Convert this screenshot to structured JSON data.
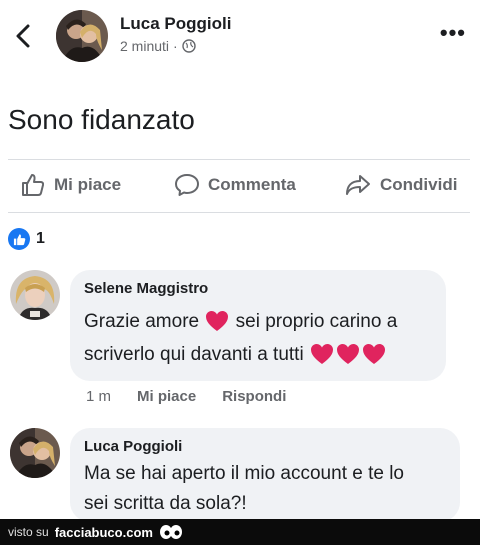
{
  "post": {
    "author": "Luca Poggioli",
    "time": "2 minuti",
    "separator": "·",
    "privacy_icon": "globe-icon",
    "text": "Sono fidanzato"
  },
  "actions": {
    "like": "Mi piace",
    "comment": "Commenta",
    "share": "Condividi"
  },
  "reactions": {
    "count": "1",
    "icon": "thumbs-up-icon"
  },
  "comments": [
    {
      "author": "Selene Maggistro",
      "line1": "Grazie amore",
      "line1b": "sei proprio carino a",
      "line2": "scriverlo qui davanti a tutti",
      "time": "1 m",
      "like_label": "Mi piace",
      "reply_label": "Rispondi"
    },
    {
      "author": "Luca Poggioli",
      "line1": "Ma se hai aperto il mio account e te lo",
      "line2": "sei scritta da sola?!"
    }
  ],
  "watermark": {
    "prefix": "visto su",
    "site": "facciabuco.com"
  },
  "colors": {
    "accent": "#1877f2",
    "heart": "#e0245e",
    "bubble": "#f0f2f5",
    "muted": "#65676b"
  }
}
